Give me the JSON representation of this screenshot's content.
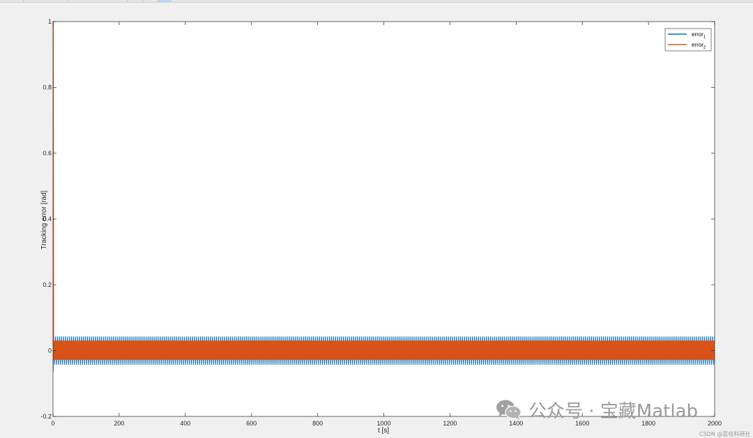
{
  "figure": {
    "watermark": "公众号 · 宝藏Matlab",
    "source_mark": "CSDN @荔枝科研社"
  },
  "chart_data": {
    "type": "line",
    "xlabel": "t [s]",
    "ylabel": "Tracking error [rad]",
    "xlim": [
      0,
      2000
    ],
    "ylim": [
      -0.2,
      1
    ],
    "xticks": [
      0,
      200,
      400,
      600,
      800,
      1000,
      1200,
      1400,
      1600,
      1800,
      2000
    ],
    "yticks": [
      -0.2,
      0,
      0.2,
      0.4,
      0.6,
      0.8,
      1
    ],
    "ytick_labels": [
      "-0.2",
      "0",
      "0.2",
      "0.4",
      "0.6",
      "0.8",
      "1"
    ],
    "grid": false,
    "legend_position": "top-right",
    "series": [
      {
        "name": "error",
        "name_subscript": "1",
        "color": "#0072bd",
        "behavior": "initial transient to about -0.065, then steady oscillation",
        "initial_value": -0.065,
        "oscillation_min": -0.043,
        "oscillation_max": 0.043
      },
      {
        "name": "error",
        "name_subscript": "2",
        "color": "#d95319",
        "behavior": "starts at 1, drops to oscillation band",
        "initial_value": 1,
        "oscillation_min": -0.028,
        "oscillation_max": 0.03
      }
    ]
  }
}
